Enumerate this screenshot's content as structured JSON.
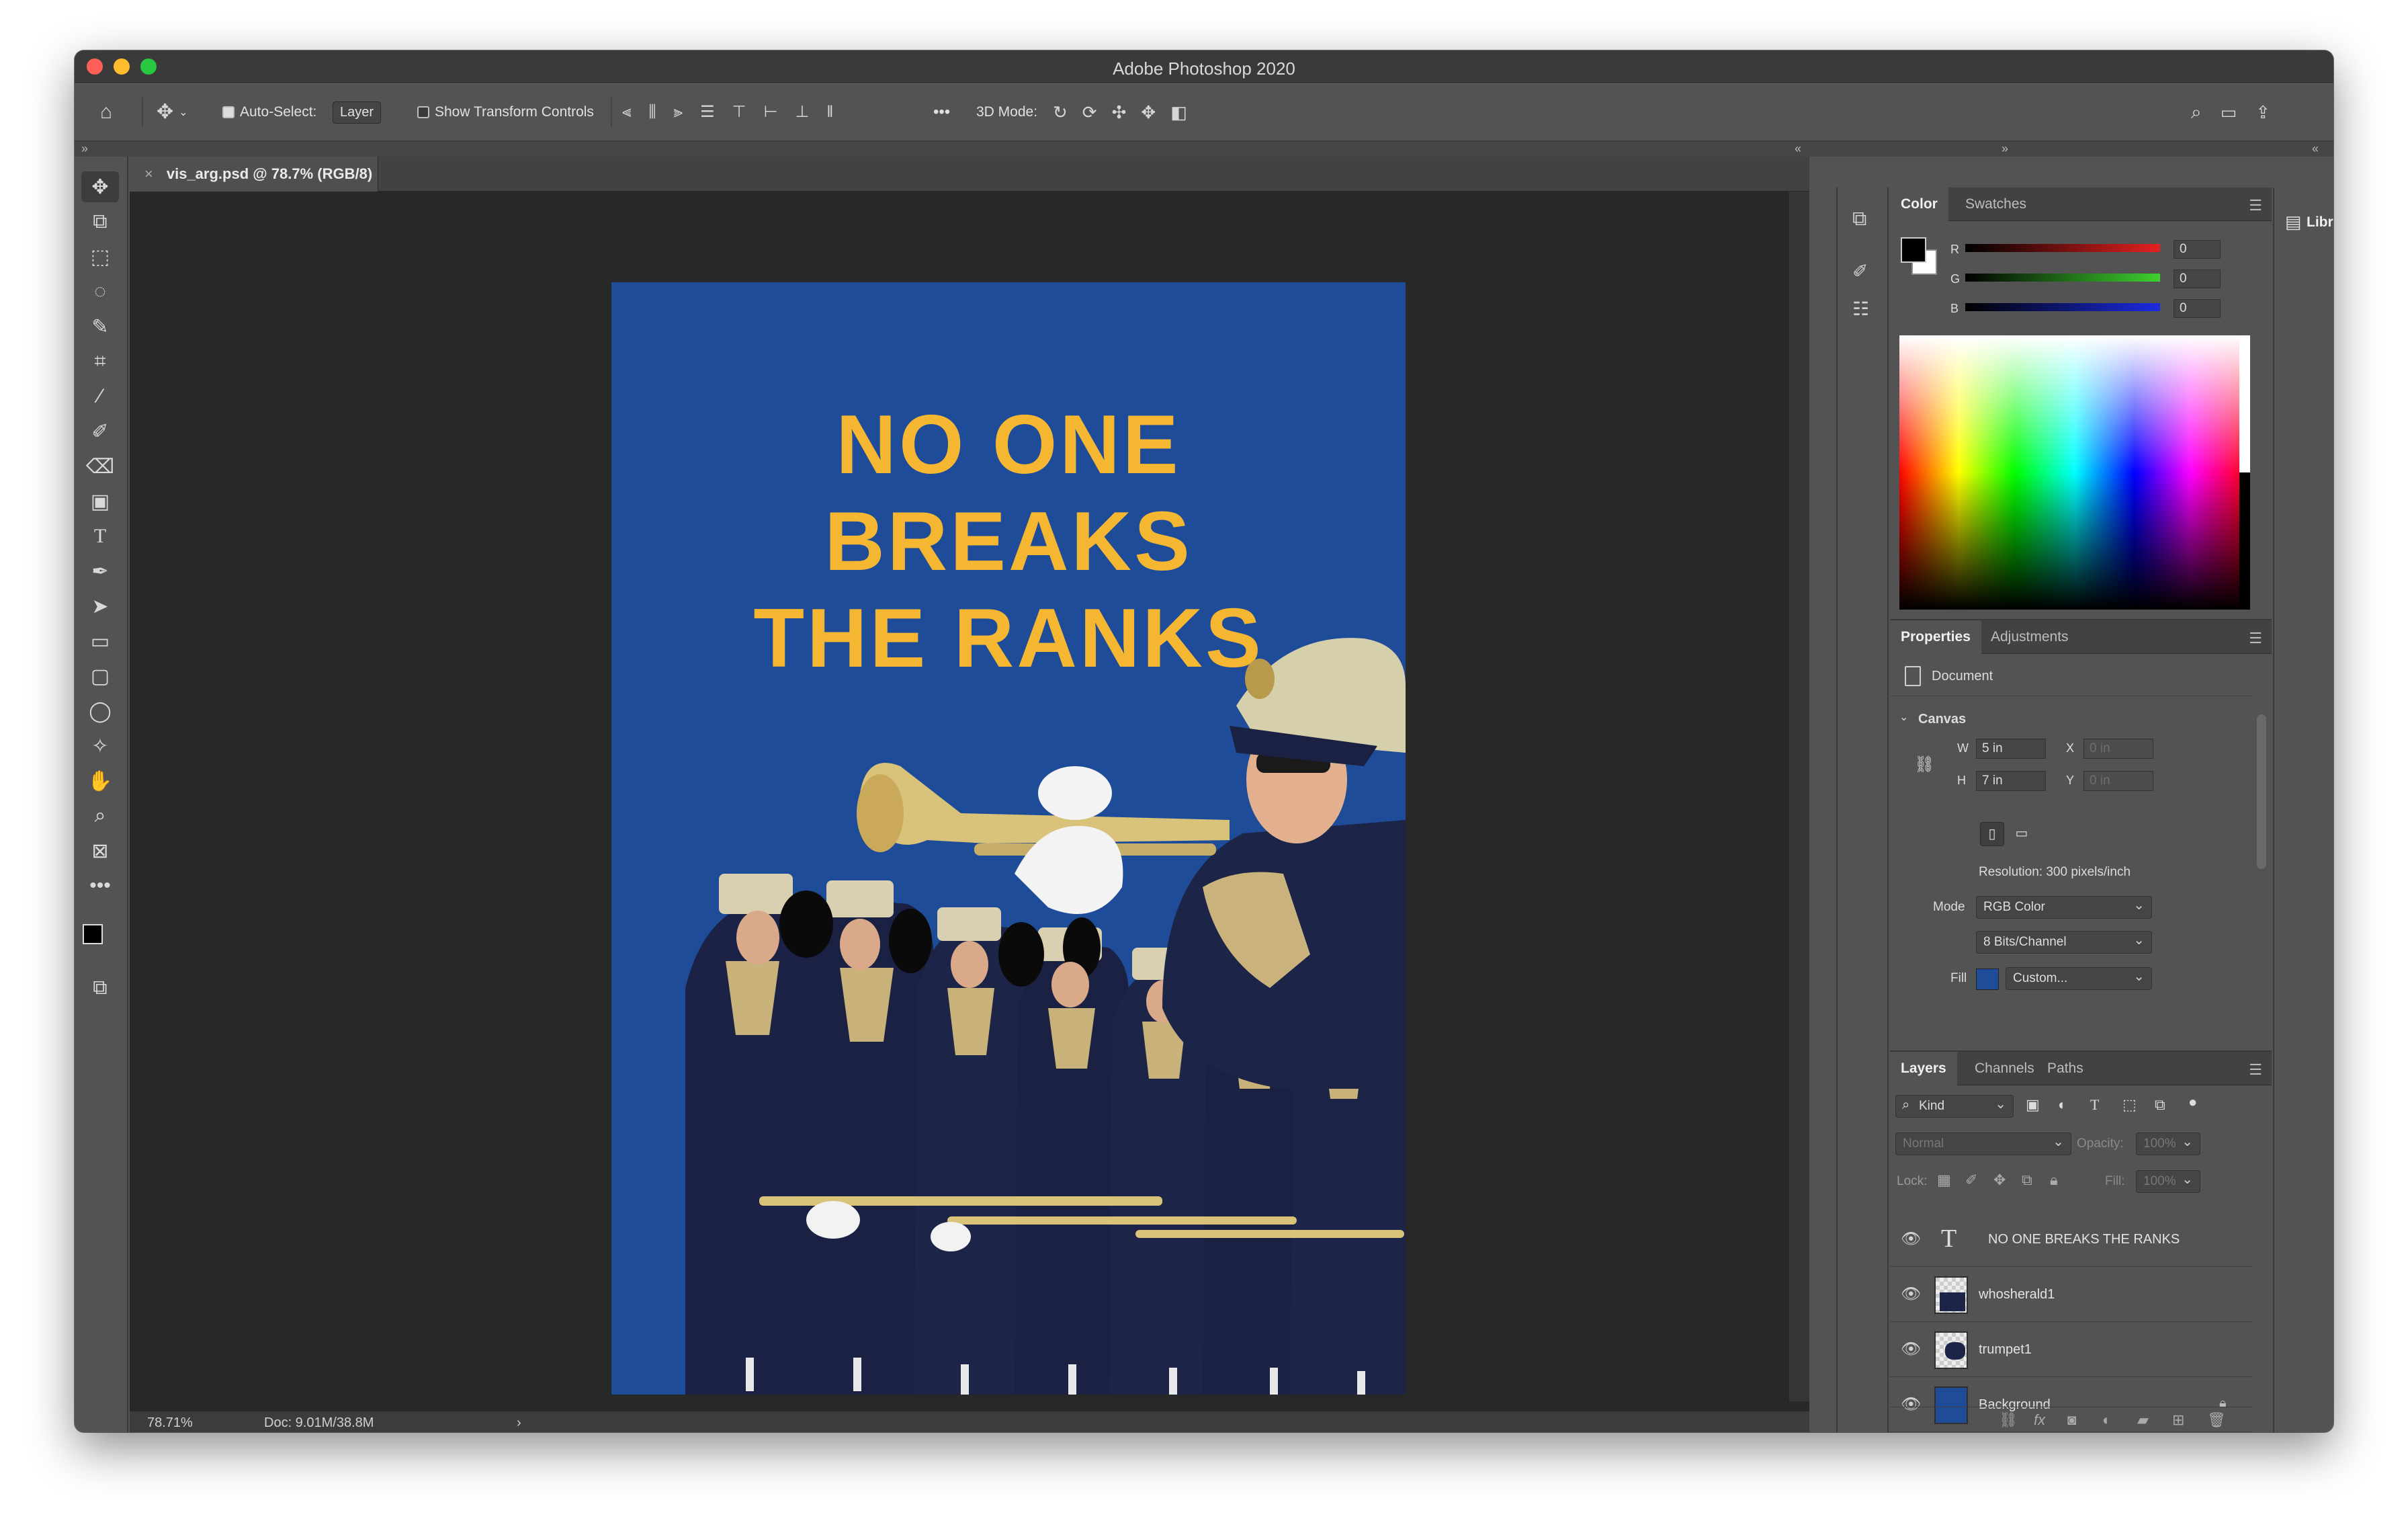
{
  "app": {
    "title": "Adobe Photoshop 2020"
  },
  "options_bar": {
    "auto_select_label": "Auto-Select:",
    "auto_select_value": "Layer",
    "show_transform_label": "Show Transform Controls",
    "mode_3d_label": "3D Mode:",
    "more": "•••"
  },
  "document": {
    "tab_title": "vis_arg.psd @ 78.7% (RGB/8)",
    "headline_line1": "NO ONE",
    "headline_line2": "BREAKS",
    "headline_line3": "THE RANKS",
    "background_color": "#1e4c99",
    "text_color": "#f5b731"
  },
  "status_bar": {
    "zoom": "78.71%",
    "doc_size": "Doc: 9.01M/38.8M",
    "arrow": "›"
  },
  "color_panel": {
    "tabs": [
      "Color",
      "Swatches"
    ],
    "r_label": "R",
    "g_label": "G",
    "b_label": "B",
    "r_value": "0",
    "g_value": "0",
    "b_value": "0"
  },
  "properties_panel": {
    "tabs": [
      "Properties",
      "Adjustments"
    ],
    "section_document": "Document",
    "section_canvas": "Canvas",
    "w_label": "W",
    "w_value": "5 in",
    "h_label": "H",
    "h_value": "7 in",
    "x_label": "X",
    "x_value": "0 in",
    "y_label": "Y",
    "y_value": "0 in",
    "resolution": "Resolution: 300 pixels/inch",
    "mode_label": "Mode",
    "mode_value": "RGB Color",
    "bits_value": "8 Bits/Channel",
    "fill_label": "Fill",
    "fill_value": "Custom..."
  },
  "layers_panel": {
    "tabs": [
      "Layers",
      "Channels",
      "Paths"
    ],
    "filter_value": "Kind",
    "blend_value": "Normal",
    "opacity_label": "Opacity:",
    "opacity_value": "100%",
    "lock_label": "Lock:",
    "fill_label": "Fill:",
    "fill_value": "100%",
    "layers": [
      {
        "name": "NO ONE BREAKS THE RANKS",
        "type": "text"
      },
      {
        "name": "whosherald1",
        "type": "image"
      },
      {
        "name": "trumpet1",
        "type": "image"
      },
      {
        "name": "Background",
        "type": "fill",
        "locked": true
      }
    ]
  },
  "libraries_panel": {
    "title": "Libraries"
  },
  "icons": [
    "home-icon",
    "move-icon",
    "artboard-icon",
    "marquee-icon",
    "lasso-icon",
    "quick-select-icon",
    "crop-icon",
    "eyedropper-icon",
    "brush-icon",
    "eraser-icon",
    "gradient-icon",
    "type-icon",
    "pen-icon",
    "path-select-icon",
    "rectangle-icon",
    "rounded-rect-icon",
    "ellipse-icon",
    "custom-shape-icon",
    "hand-icon",
    "zoom-icon",
    "frame-icon",
    "search-icon",
    "workspace-icon",
    "share-icon",
    "eye-icon",
    "lock-icon"
  ]
}
